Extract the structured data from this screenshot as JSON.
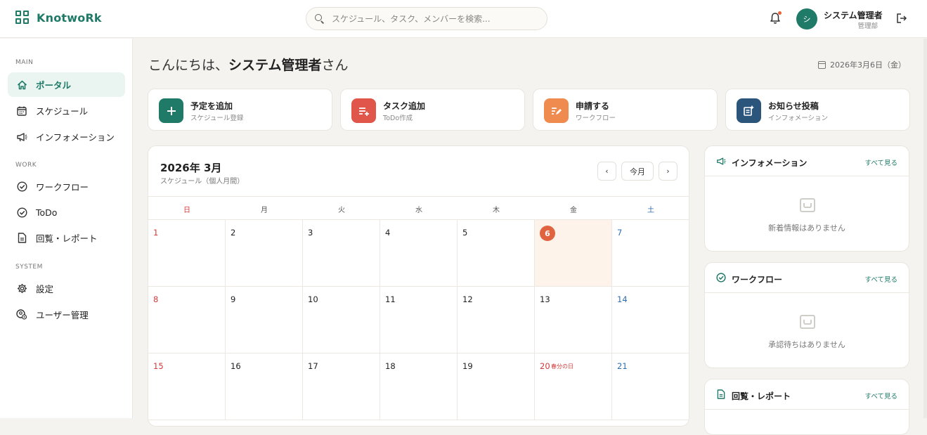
{
  "header": {
    "logo": "KnotwoRk",
    "search_placeholder": "スケジュール、タスク、メンバーを検索...",
    "user_name": "システム管理者",
    "user_dept": "管理部",
    "avatar_initial": "シ"
  },
  "sidebar": {
    "sections": [
      "MAIN",
      "WORK",
      "SYSTEM"
    ],
    "items": [
      {
        "label": "ポータル",
        "icon": "home-icon"
      },
      {
        "label": "スケジュール",
        "icon": "calendar-icon"
      },
      {
        "label": "インフォメーション",
        "icon": "megaphone-icon"
      },
      {
        "label": "ワークフロー",
        "icon": "check-circle-icon"
      },
      {
        "label": "ToDo",
        "icon": "check-circle-icon"
      },
      {
        "label": "回覧・レポート",
        "icon": "document-icon"
      },
      {
        "label": "設定",
        "icon": "gear-icon"
      },
      {
        "label": "ユーザー管理",
        "icon": "user-settings-icon"
      }
    ]
  },
  "greeting": {
    "prefix": "こんにちは、",
    "name": "システム管理者",
    "suffix": "さん"
  },
  "today_date": "2026年3月6日（金）",
  "quick_actions": [
    {
      "title": "予定を追加",
      "sub": "スケジュール登録",
      "color": "#1f7a68"
    },
    {
      "title": "タスク追加",
      "sub": "ToDo作成",
      "color": "#e0564b"
    },
    {
      "title": "申請する",
      "sub": "ワークフロー",
      "color": "#ef8b4f"
    },
    {
      "title": "お知らせ投稿",
      "sub": "インフォメーション",
      "color": "#2b557a"
    }
  ],
  "calendar": {
    "title": "2026年 3月",
    "subtitle": "スケジュール（個人月間）",
    "today_button": "今月",
    "prev": "‹",
    "next": "›",
    "weekdays": [
      "日",
      "月",
      "火",
      "水",
      "木",
      "金",
      "土"
    ],
    "weeks": [
      [
        "1",
        "2",
        "3",
        "4",
        "5",
        "6",
        "7"
      ],
      [
        "8",
        "9",
        "10",
        "11",
        "12",
        "13",
        "14"
      ],
      [
        "15",
        "16",
        "17",
        "18",
        "19",
        "20",
        "21"
      ]
    ],
    "today": "6",
    "holiday": {
      "day": "20",
      "label": "春分の日"
    }
  },
  "panels": [
    {
      "title": "インフォメーション",
      "link": "すべて見る",
      "empty": "新着情報はありません"
    },
    {
      "title": "ワークフロー",
      "link": "すべて見る",
      "empty": "承認待ちはありません"
    },
    {
      "title": "回覧・レポート",
      "link": "すべて見る",
      "empty": ""
    }
  ]
}
